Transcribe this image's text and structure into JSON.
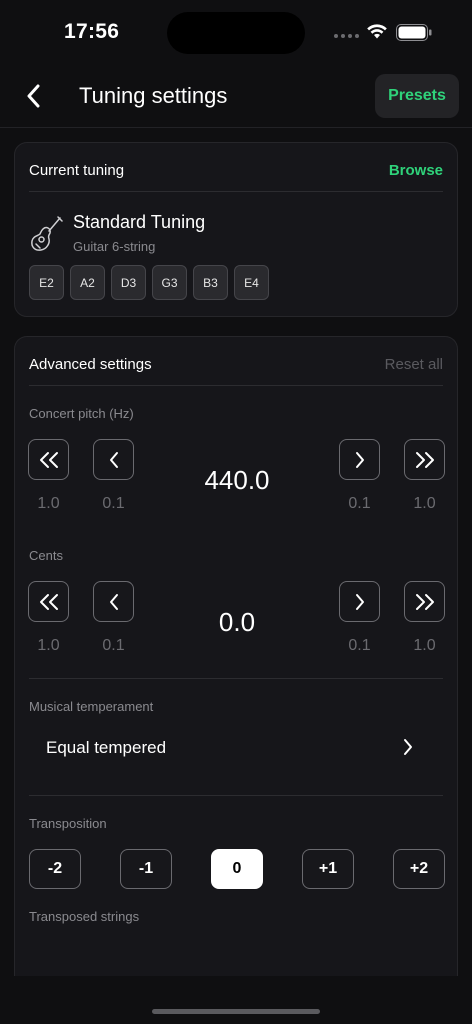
{
  "status": {
    "time": "17:56"
  },
  "nav": {
    "title": "Tuning settings",
    "presets_label": "Presets"
  },
  "current_tuning": {
    "header": "Current tuning",
    "browse_label": "Browse",
    "name": "Standard Tuning",
    "subtitle": "Guitar 6-string",
    "strings": [
      "E2",
      "A2",
      "D3",
      "G3",
      "B3",
      "E4"
    ]
  },
  "advanced": {
    "header": "Advanced settings",
    "reset_label": "Reset all",
    "concert_pitch": {
      "label": "Concert pitch (Hz)",
      "value": "440.0",
      "steps": [
        "1.0",
        "0.1",
        "0.1",
        "1.0"
      ]
    },
    "cents": {
      "label": "Cents",
      "value": "0.0",
      "steps": [
        "1.0",
        "0.1",
        "0.1",
        "1.0"
      ]
    },
    "temperament": {
      "label": "Musical temperament",
      "value": "Equal tempered"
    },
    "transposition": {
      "label": "Transposition",
      "options": [
        "-2",
        "-1",
        "0",
        "+1",
        "+2"
      ],
      "selected": "0"
    },
    "transposed_strings_label": "Transposed strings"
  },
  "colors": {
    "accent": "#2fd27a",
    "background": "#0f0f11",
    "card": "#16161a"
  },
  "icons": [
    "back-chevron-icon",
    "guitar-icon",
    "double-chevron-left-icon",
    "chevron-left-icon",
    "chevron-right-icon",
    "double-chevron-right-icon",
    "wifi-icon",
    "battery-icon"
  ]
}
